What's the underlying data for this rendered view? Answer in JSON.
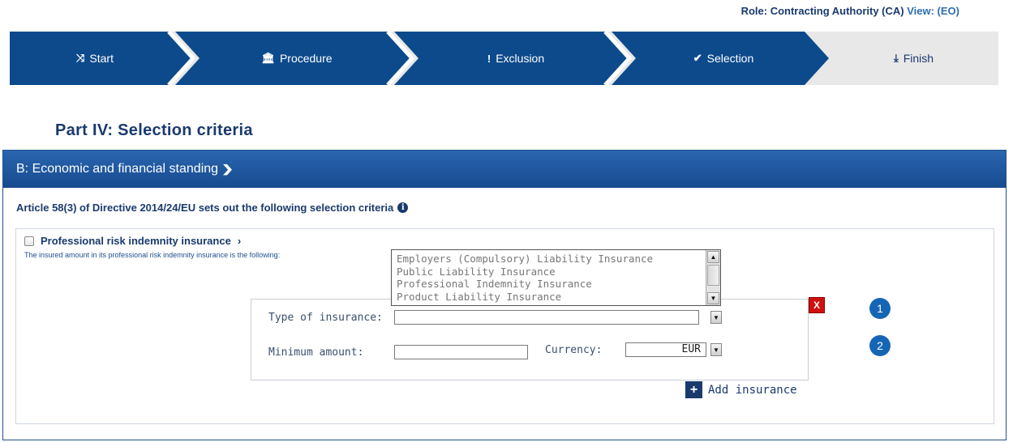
{
  "role": {
    "label": "Role: Contracting Authority (CA)",
    "view_link": "View: (EO)"
  },
  "wizard": {
    "steps": [
      {
        "label": "Start",
        "icon": "shuffle-icon",
        "glyph": "⤨"
      },
      {
        "label": "Procedure",
        "icon": "bank-icon",
        "glyph": "🏛"
      },
      {
        "label": "Exclusion",
        "icon": "exclamation-icon",
        "glyph": "!"
      },
      {
        "label": "Selection",
        "icon": "check-circle-icon",
        "glyph": "✔"
      },
      {
        "label": "Finish",
        "icon": "download-icon",
        "glyph": "⤓"
      }
    ],
    "active_color": "#0d4a8c",
    "inactive_color": "#e8e8e8"
  },
  "page_title": "Part IV: Selection criteria",
  "section": {
    "title": "B: Economic and financial standing",
    "chevron": "❯"
  },
  "article_text": "Article 58(3) of Directive 2014/24/EU sets out the following selection criteria",
  "info_glyph": "i",
  "criterion": {
    "title": "Professional risk indemnity insurance",
    "chevron": "›",
    "description": "The insured amount in its professional risk indemnity insurance is the following:",
    "checked": false
  },
  "insurance_options": [
    "Employers (Compulsory) Liability Insurance",
    "Public Liability Insurance",
    "Professional Indemnity Insurance",
    "Product Liability Insurance"
  ],
  "form": {
    "type_label": "Type of insurance:",
    "type_value": "",
    "min_amount_label": "Minimum amount:",
    "min_amount_value": "",
    "currency_label": "Currency:",
    "currency_value": "EUR"
  },
  "remove_glyph": "X",
  "badges": [
    "1",
    "2"
  ],
  "add_button": {
    "glyph": "+",
    "label": "Add insurance"
  },
  "scroll_glyphs": {
    "up": "▲",
    "down": "▼"
  }
}
